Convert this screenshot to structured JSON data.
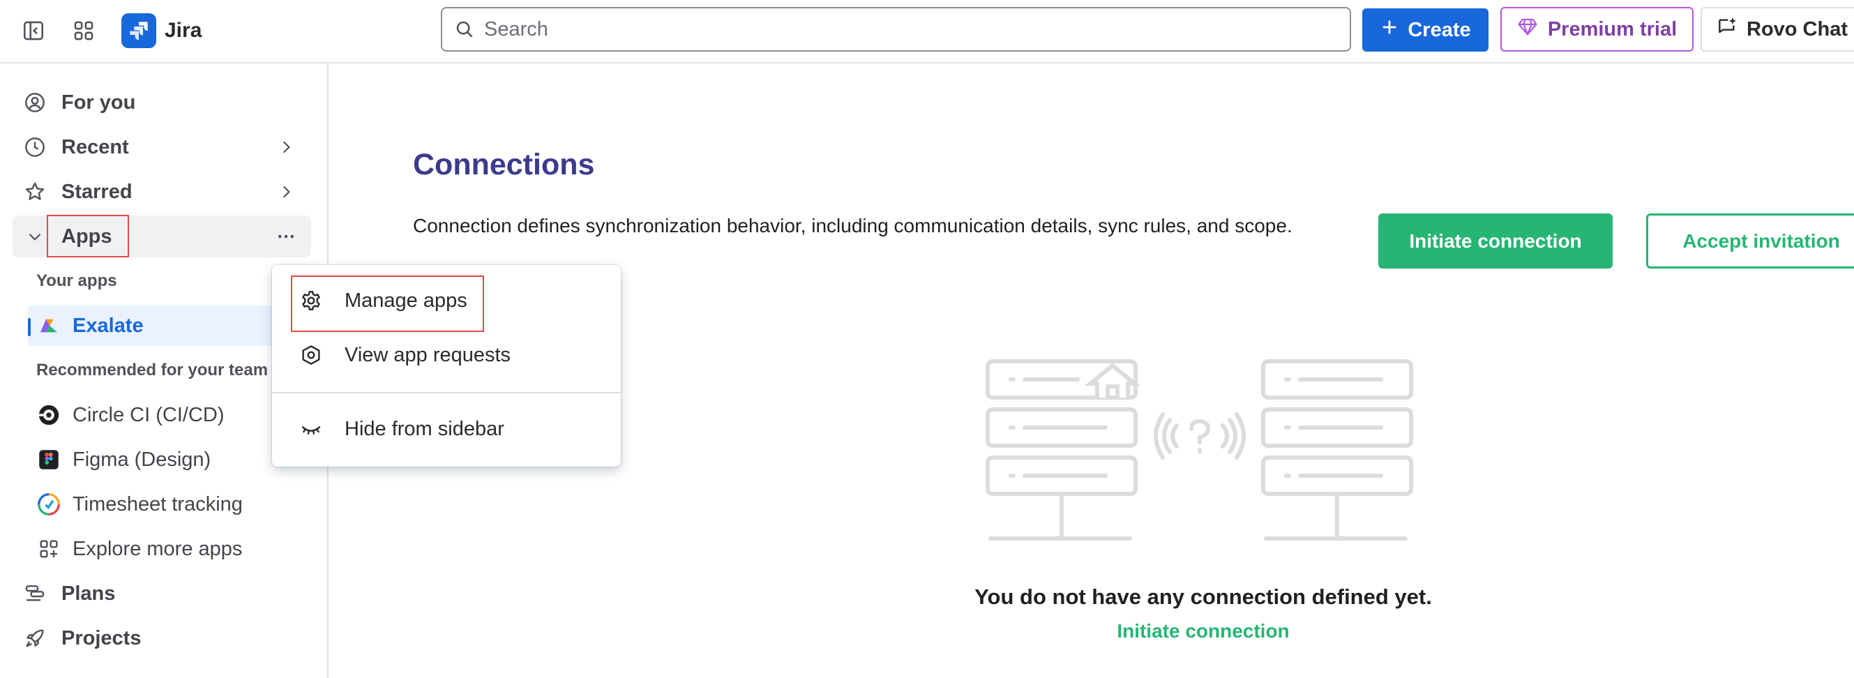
{
  "topbar": {
    "app_name": "Jira",
    "search_placeholder": "Search",
    "create_label": "Create",
    "premium_label": "Premium trial",
    "rovo_label": "Rovo Chat",
    "icons": [
      "sidebar-toggle-icon",
      "app-switcher-icon",
      "jira-logo-icon",
      "search-icon",
      "plus-icon",
      "diamond-icon",
      "rovo-chat-icon"
    ]
  },
  "sidebar": {
    "items": [
      {
        "label": "For you",
        "icon": "user-circle-icon"
      },
      {
        "label": "Recent",
        "icon": "clock-icon"
      },
      {
        "label": "Starred",
        "icon": "star-icon"
      },
      {
        "label": "Apps",
        "icon": "chevron-down-icon"
      },
      {
        "label": "Plans",
        "icon": "plans-icon"
      },
      {
        "label": "Projects",
        "icon": "rocket-icon"
      }
    ],
    "your_apps_heading": "Your apps",
    "your_apps": [
      {
        "label": "Exalate",
        "icon": "exalate-icon",
        "active": true
      }
    ],
    "recommended_heading": "Recommended for your team",
    "recommended": [
      {
        "label": "Circle CI (CI/CD)",
        "icon": "circleci-icon"
      },
      {
        "label": "Figma (Design)",
        "icon": "figma-icon"
      },
      {
        "label": "Timesheet tracking",
        "icon": "timesheet-icon"
      },
      {
        "label": "Explore more apps",
        "icon": "explore-apps-icon"
      }
    ]
  },
  "apps_menu": {
    "items": [
      {
        "label": "Manage apps",
        "icon": "gear-icon"
      },
      {
        "label": "View app requests",
        "icon": "hexagon-settings-icon"
      },
      {
        "label": "Hide from sidebar",
        "icon": "eye-closed-icon"
      }
    ]
  },
  "main": {
    "title": "Connections",
    "description": "Connection defines synchronization behavior, including communication details, sync rules, and scope.",
    "initiate_button": "Initiate connection",
    "accept_button": "Accept invitation",
    "empty_title": "You do not have any connection defined yet.",
    "empty_link": "Initiate connection"
  },
  "colors": {
    "brand_blue": "#1868db",
    "premium_purple": "#803fa5",
    "exalate_green": "#26b573",
    "title_indigo": "#3b3a8c",
    "highlight_red": "#e5484d"
  }
}
